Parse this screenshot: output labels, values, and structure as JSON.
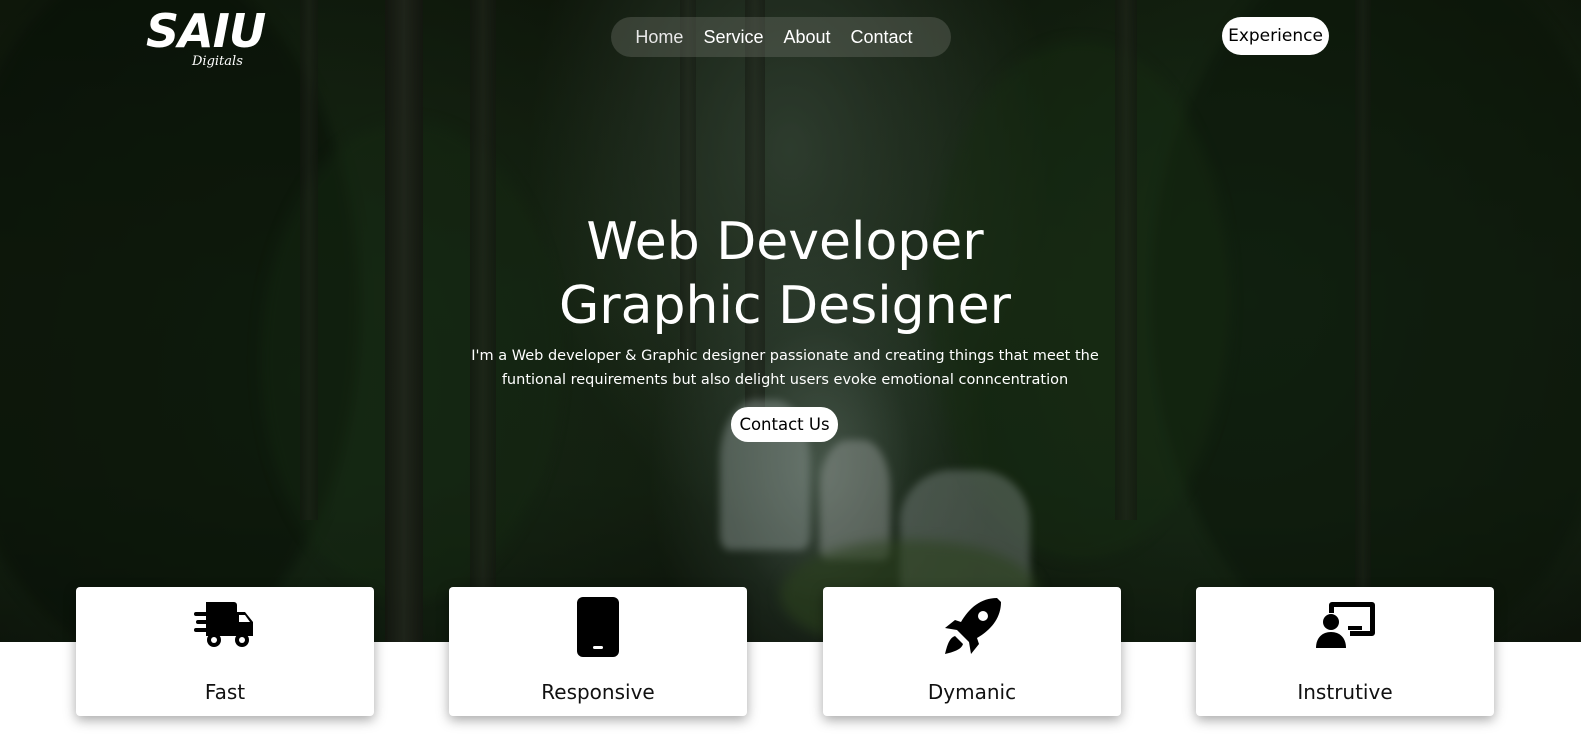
{
  "logo": {
    "main": "SAIU",
    "sub": "Digitals"
  },
  "nav": {
    "items": [
      {
        "label": "Home"
      },
      {
        "label": "Service"
      },
      {
        "label": "About"
      },
      {
        "label": "Contact"
      }
    ]
  },
  "header": {
    "experience_label": "Experience"
  },
  "hero": {
    "title_line1": "Web Developer",
    "title_line2": "Graphic Designer",
    "description_line1": "I'm a Web developer & Graphic designer passionate and creating things that meet the",
    "description_line2": "funtional requirements but also delight users evoke emotional conncentration",
    "cta_label": "Contact Us"
  },
  "features": [
    {
      "label": "Fast",
      "icon": "delivery-truck-icon"
    },
    {
      "label": "Responsive",
      "icon": "mobile-phone-icon"
    },
    {
      "label": "Dymanic",
      "icon": "rocket-icon"
    },
    {
      "label": "Instrutive",
      "icon": "teacher-icon"
    }
  ],
  "colors": {
    "accent": "#ffffff",
    "text_dark": "#111111"
  }
}
